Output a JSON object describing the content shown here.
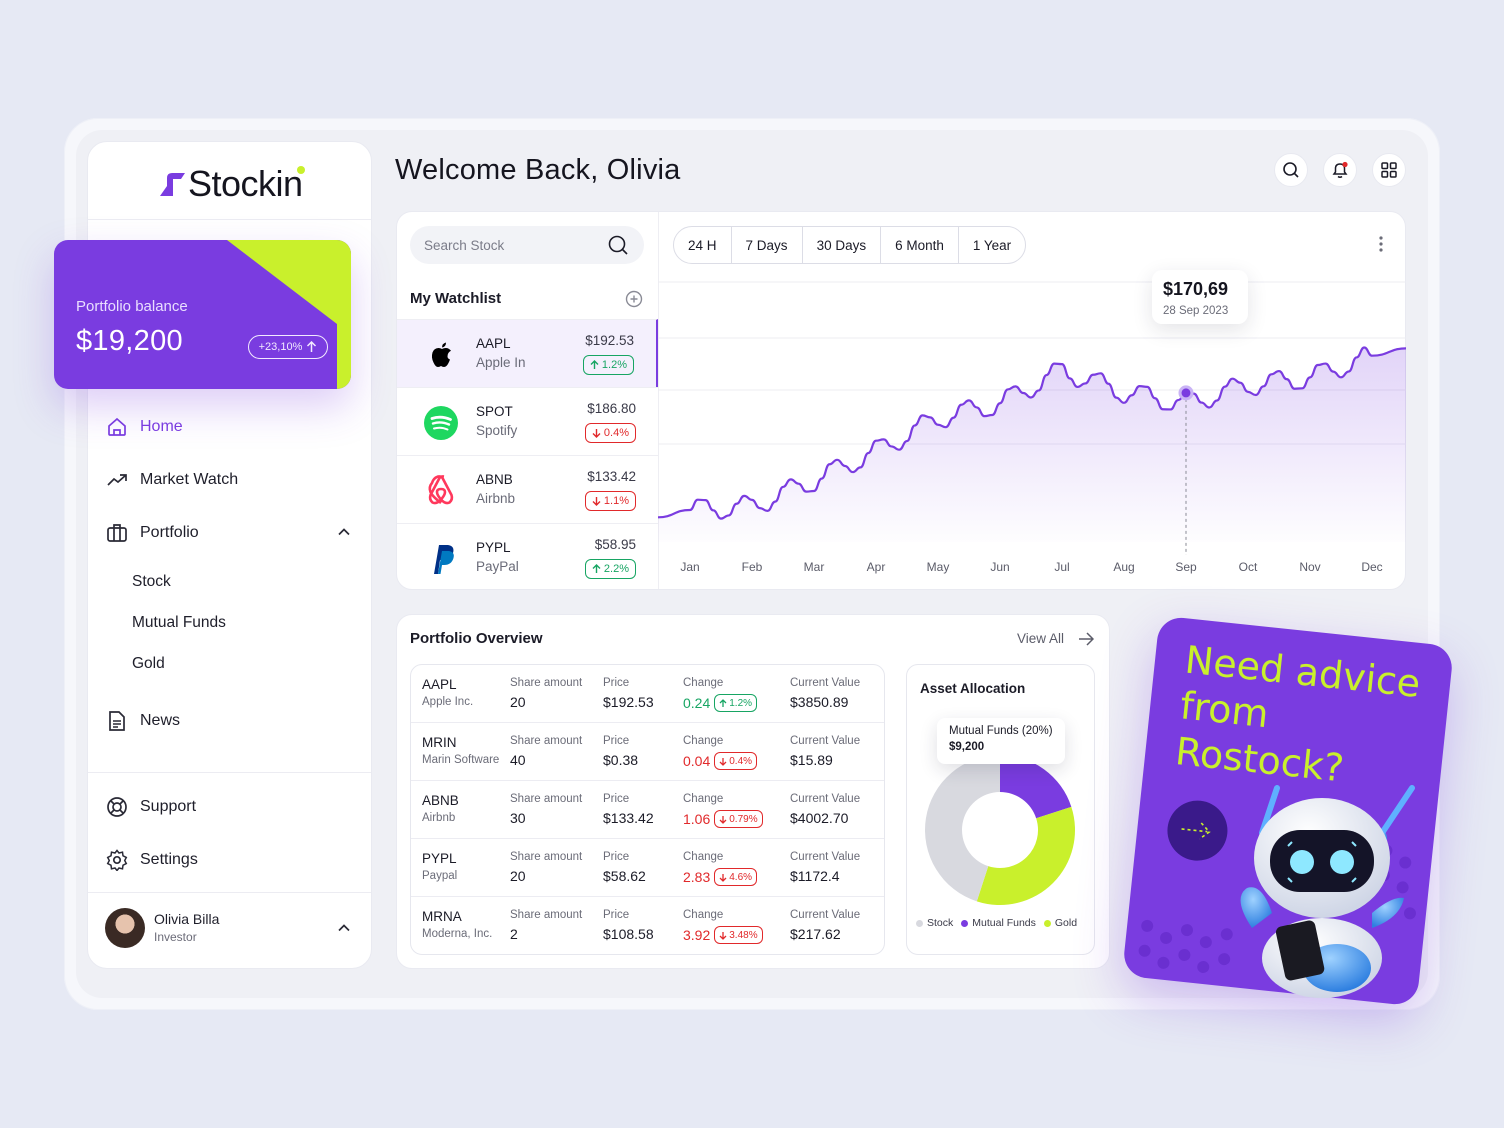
{
  "app": {
    "logo_text": "Stockin"
  },
  "balance": {
    "label": "Portfolio balance",
    "value": "$19,200",
    "change": "+23,10%"
  },
  "nav": {
    "home": "Home",
    "market_watch": "Market Watch",
    "portfolio": "Portfolio",
    "sub": [
      "Stock",
      "Mutual Funds",
      "Gold"
    ],
    "news": "News",
    "support": "Support",
    "settings": "Settings"
  },
  "user": {
    "name": "Olivia Billa",
    "role": "Investor"
  },
  "header": {
    "welcome": "Welcome Back, Olivia"
  },
  "search": {
    "placeholder": "Search Stock"
  },
  "watchlist": {
    "title": "My Watchlist",
    "items": [
      {
        "symbol": "AAPL",
        "name": "Apple In",
        "price": "$192.53",
        "change": "1.2%",
        "direction": "up"
      },
      {
        "symbol": "SPOT",
        "name": "Spotify",
        "price": "$186.80",
        "change": "0.4%",
        "direction": "down"
      },
      {
        "symbol": "ABNB",
        "name": "Airbnb",
        "price": "$133.42",
        "change": "1.1%",
        "direction": "down"
      },
      {
        "symbol": "PYPL",
        "name": "PayPal",
        "price": "$58.95",
        "change": "2.2%",
        "direction": "up"
      }
    ]
  },
  "ranges": [
    "24 H",
    "7 Days",
    "30 Days",
    "6 Month",
    "1 Year"
  ],
  "chart_tooltip": {
    "value": "$170,69",
    "date": "28 Sep 2023"
  },
  "chart_data": {
    "type": "line",
    "x": [
      "Jan",
      "Feb",
      "Mar",
      "Apr",
      "May",
      "Jun",
      "Jul",
      "Aug",
      "Sep",
      "Oct",
      "Nov",
      "Dec"
    ],
    "series": [
      {
        "values": [
          12,
          14,
          28,
          44,
          62,
          70,
          88,
          76,
          70,
          80,
          84,
          96
        ]
      }
    ],
    "highlight": {
      "x": "Sep",
      "value": "$170,69"
    }
  },
  "portfolio_overview": {
    "title": "Portfolio Overview",
    "view_all": "View All",
    "labels": {
      "share": "Share amount",
      "price": "Price",
      "change": "Change",
      "value": "Current Value"
    },
    "rows": [
      {
        "symbol": "AAPL",
        "company": "Apple Inc.",
        "shares": "20",
        "price": "$192.53",
        "change": "0.24",
        "pct": "1.2%",
        "direction": "up",
        "value": "$3850.89"
      },
      {
        "symbol": "MRIN",
        "company": "Marin Software",
        "shares": "40",
        "price": "$0.38",
        "change": "0.04",
        "pct": "0.4%",
        "direction": "down",
        "value": "$15.89"
      },
      {
        "symbol": "ABNB",
        "company": "Airbnb",
        "shares": "30",
        "price": "$133.42",
        "change": "1.06",
        "pct": "0.79%",
        "direction": "down",
        "value": "$4002.70"
      },
      {
        "symbol": "PYPL",
        "company": "Paypal",
        "shares": "20",
        "price": "$58.62",
        "change": "2.83",
        "pct": "4.6%",
        "direction": "down",
        "value": "$1172.4"
      },
      {
        "symbol": "MRNA",
        "company": "Moderna, Inc.",
        "shares": "2",
        "price": "$108.58",
        "change": "3.92",
        "pct": "3.48%",
        "direction": "down",
        "value": "$217.62"
      }
    ]
  },
  "asset_allocation": {
    "title": "Asset Allocation",
    "tooltip_label": "Mutual Funds (20%)",
    "tooltip_value": "$9,200",
    "legend": [
      "Stock",
      "Mutual Funds",
      "Gold"
    ],
    "segments": [
      {
        "name": "Mutual Funds",
        "share": 0.2,
        "color": "#7a3ce0"
      },
      {
        "name": "Gold",
        "share": 0.35,
        "color": "#c9f02c"
      },
      {
        "name": "Stock",
        "share": 0.45,
        "color": "#d8d9df"
      }
    ]
  },
  "promo": {
    "text": "Need advice from Rostock?"
  },
  "colors": {
    "accent": "#7a3ce0",
    "lime": "#c9f02c",
    "up": "#17a563",
    "down": "#e1292b"
  },
  "icons": [
    "search-icon",
    "bell-icon",
    "grid-icon",
    "home-icon",
    "trend-icon",
    "briefcase-icon",
    "news-icon",
    "support-icon",
    "settings-icon"
  ]
}
